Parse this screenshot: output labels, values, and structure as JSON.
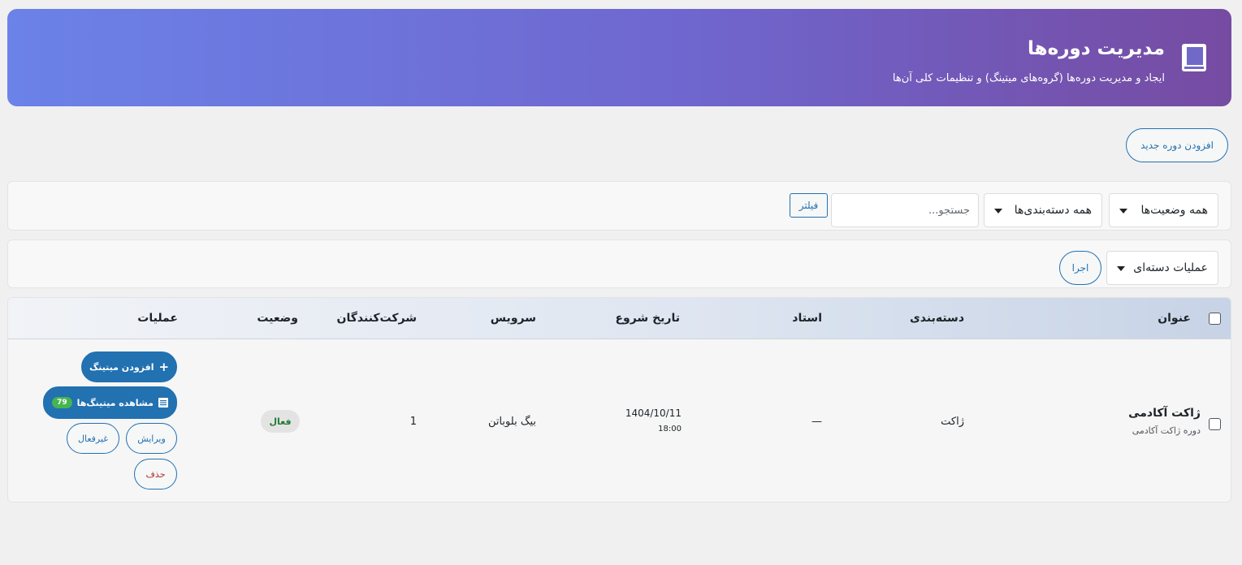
{
  "header": {
    "title": "مدیریت دوره‌ها",
    "subtitle": "ایجاد و مدیریت دوره‌ها (گروه‌های میتینگ) و تنظیمات کلی آن‌ها",
    "icon": "book-icon"
  },
  "toolbar": {
    "add_course_label": "افزودن دوره جدید"
  },
  "filters": {
    "status_selected": "همه وضعیت‌ها",
    "category_selected": "همه دسته‌بندی‌ها",
    "search_placeholder": "جستجو...",
    "filter_label": "فیلتر"
  },
  "bulk": {
    "actions_selected": "عملیات دسته‌ای",
    "apply_label": "اجرا"
  },
  "table": {
    "columns": {
      "title": "عنوان",
      "category": "دسته‌بندی",
      "teacher": "استاد",
      "start_date": "تاریخ شروع",
      "service": "سرویس",
      "participants": "شرکت‌کنندگان",
      "status": "وضعیت",
      "actions": "عملیات"
    },
    "rows": [
      {
        "title": "ژاکت آکادمی",
        "subtitle": "دوره ژاکت آکادمی",
        "category": "ژاکت",
        "teacher": "—",
        "start_date": "1404/10/11",
        "start_time": "18:00",
        "service": "بیگ بلوباتن",
        "participants": "1",
        "status": "فعال",
        "actions": {
          "add_meeting": "افزودن میتینگ",
          "view_meetings": "مشاهده میتینگ‌ها",
          "meetings_count": "79",
          "edit": "ویرایش",
          "deactivate": "غیرفعال",
          "delete": "حذف"
        }
      }
    ]
  },
  "colors": {
    "header_gradient_start": "#6b82e8",
    "header_gradient_end": "#764ba2",
    "primary": "#2271b1",
    "status_active": "#1e7b34",
    "danger": "#b32d2e",
    "count_badge": "#46b450"
  }
}
